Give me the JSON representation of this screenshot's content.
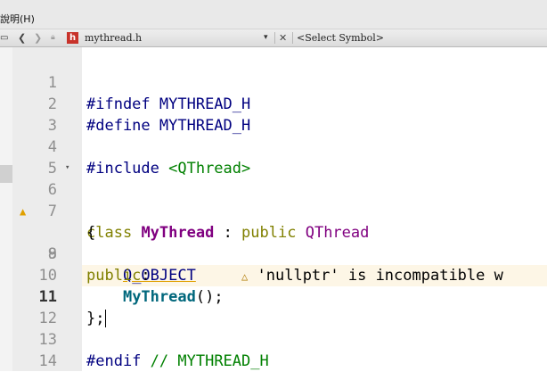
{
  "menubar": {
    "help_label": "說明(H)"
  },
  "toolbar": {
    "split_icon": "split-view-icon",
    "back_icon": "back-arrow",
    "forward_icon": "forward-arrow",
    "lock_icon": "lock-icon",
    "file_type_badge": "h",
    "filename": "mythread.h",
    "dropdown_glyph": "▾",
    "close_glyph": "✕",
    "symbol_placeholder": "<Select Symbol>"
  },
  "editor": {
    "current_line": 11,
    "lines": [
      {
        "n": "1",
        "t1": "#ifndef",
        "t2": " MYTHREAD_H"
      },
      {
        "n": "2",
        "t1": "#define",
        "t2": " MYTHREAD_H"
      },
      {
        "n": "3"
      },
      {
        "n": "4",
        "t1": "#include",
        "t2": " <QThread>"
      },
      {
        "n": "5"
      },
      {
        "n": "6",
        "t1": "class",
        "t2": " ",
        "t3": "MyThread",
        "t4": " : ",
        "t5": "public",
        "t6": " ",
        "t7": "QThread"
      },
      {
        "n": "7",
        "t1": "{"
      },
      {
        "n": "8",
        "t1": "    ",
        "t2": "Q_OBJECT",
        "warning": "'nullptr' is incompatible w"
      },
      {
        "n": "9",
        "t1": "public",
        "t2": ":"
      },
      {
        "n": "10",
        "t1": "    ",
        "t2": "MyThread",
        "t3": "();"
      },
      {
        "n": "11",
        "t1": "};"
      },
      {
        "n": "12"
      },
      {
        "n": "13",
        "t1": "#endif",
        "t2": " ",
        "t3": "// MYTHREAD_H"
      },
      {
        "n": "14"
      }
    ]
  },
  "colors": {
    "preprocessor": "#000080",
    "keyword": "#808000",
    "include_string": "#008000",
    "class_name": "#800080",
    "function": "#00677c",
    "warning": "#e0a000"
  }
}
